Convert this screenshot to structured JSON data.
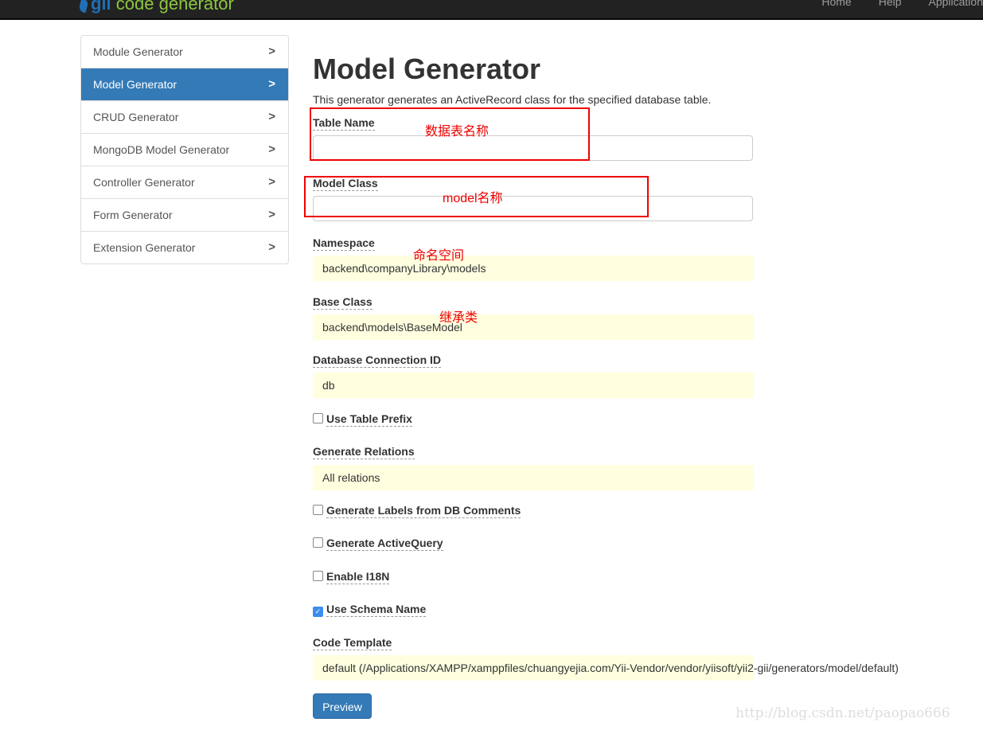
{
  "navbar": {
    "logo_gii": "gii",
    "logo_text": "code generator",
    "links": [
      "Home",
      "Help",
      "Application"
    ]
  },
  "sidebar": {
    "items": [
      {
        "label": "Module Generator",
        "active": false
      },
      {
        "label": "Model Generator",
        "active": true
      },
      {
        "label": "CRUD Generator",
        "active": false
      },
      {
        "label": "MongoDB Model Generator",
        "active": false
      },
      {
        "label": "Controller Generator",
        "active": false
      },
      {
        "label": "Form Generator",
        "active": false
      },
      {
        "label": "Extension Generator",
        "active": false
      }
    ]
  },
  "main": {
    "title": "Model Generator",
    "description": "This generator generates an ActiveRecord class for the specified database table.",
    "fields": {
      "table_name": {
        "label": "Table Name",
        "value": ""
      },
      "model_class": {
        "label": "Model Class",
        "value": ""
      },
      "namespace": {
        "label": "Namespace",
        "value": "backend\\companyLibrary\\models"
      },
      "base_class": {
        "label": "Base Class",
        "value": "backend\\models\\BaseModel"
      },
      "db": {
        "label": "Database Connection ID",
        "value": "db"
      },
      "use_table_prefix": {
        "label": "Use Table Prefix",
        "checked": false
      },
      "generate_relations": {
        "label": "Generate Relations",
        "value": "All relations"
      },
      "labels_from_db": {
        "label": "Generate Labels from DB Comments",
        "checked": false
      },
      "active_query": {
        "label": "Generate ActiveQuery",
        "checked": false
      },
      "i18n": {
        "label": "Enable I18N",
        "checked": false
      },
      "schema_name": {
        "label": "Use Schema Name",
        "checked": true
      },
      "code_template": {
        "label": "Code Template",
        "value": "default (/Applications/XAMPP/xamppfiles/chuangyejia.com/Yii-Vendor/vendor/yiisoft/yii2-gii/generators/model/default)"
      }
    },
    "preview_label": "Preview"
  },
  "annotations": {
    "table_name": "数据表名称",
    "model_class": "model名称",
    "namespace": "命名空间",
    "base_class": "继承类"
  },
  "watermark": "http://blog.csdn.net/paopao666",
  "colors": {
    "primary": "#337ab7",
    "annotation": "#ee0000",
    "sticky": "#ffffe0"
  }
}
